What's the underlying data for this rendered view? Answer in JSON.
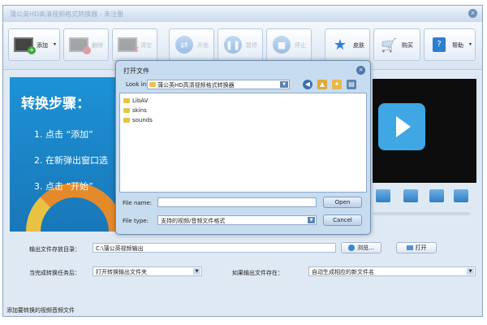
{
  "window": {
    "title": "蒲公英HD高清视频格式转换器 - 未注册",
    "close_glyph": "×"
  },
  "toolbar": {
    "add_label": "添加",
    "delete_label": "删除",
    "clear_label": "清空",
    "start_label": "开始",
    "pause_label": "暂停",
    "stop_label": "停止",
    "skin_label": "皮肤",
    "buy_label": "购买",
    "help_label": "帮助"
  },
  "steps": {
    "heading": "转换步骤：",
    "step1": "1. 点击 “添加”",
    "step2": "2. 在新弹出窗口选",
    "step3": "3. 点击 “开始”"
  },
  "output": {
    "dir_label": "输出文件存放目录：",
    "dir_value": "C:\\蒲公英视频输出",
    "browse_label": "浏览...",
    "open_label": "打开",
    "after_label": "当完成转换任务后：",
    "after_value": "打开转换输出文件夹",
    "exists_label": "如果输出文件存在：",
    "exists_value": "自动生成相应的新文件名"
  },
  "status": {
    "text": "添加要转换的视频音频文件"
  },
  "dialog": {
    "title": "打开文件",
    "look_in_label": "Look in:",
    "look_in_value": "蒲公英HD高清视频格式转换器",
    "folders": [
      "LibAV",
      "skins",
      "sounds"
    ],
    "file_name_label": "File name:",
    "file_name_value": "",
    "file_type_label": "File type:",
    "file_type_value": "支持的视频/音频文件格式",
    "open_button": "Open",
    "cancel_button": "Cancel"
  }
}
